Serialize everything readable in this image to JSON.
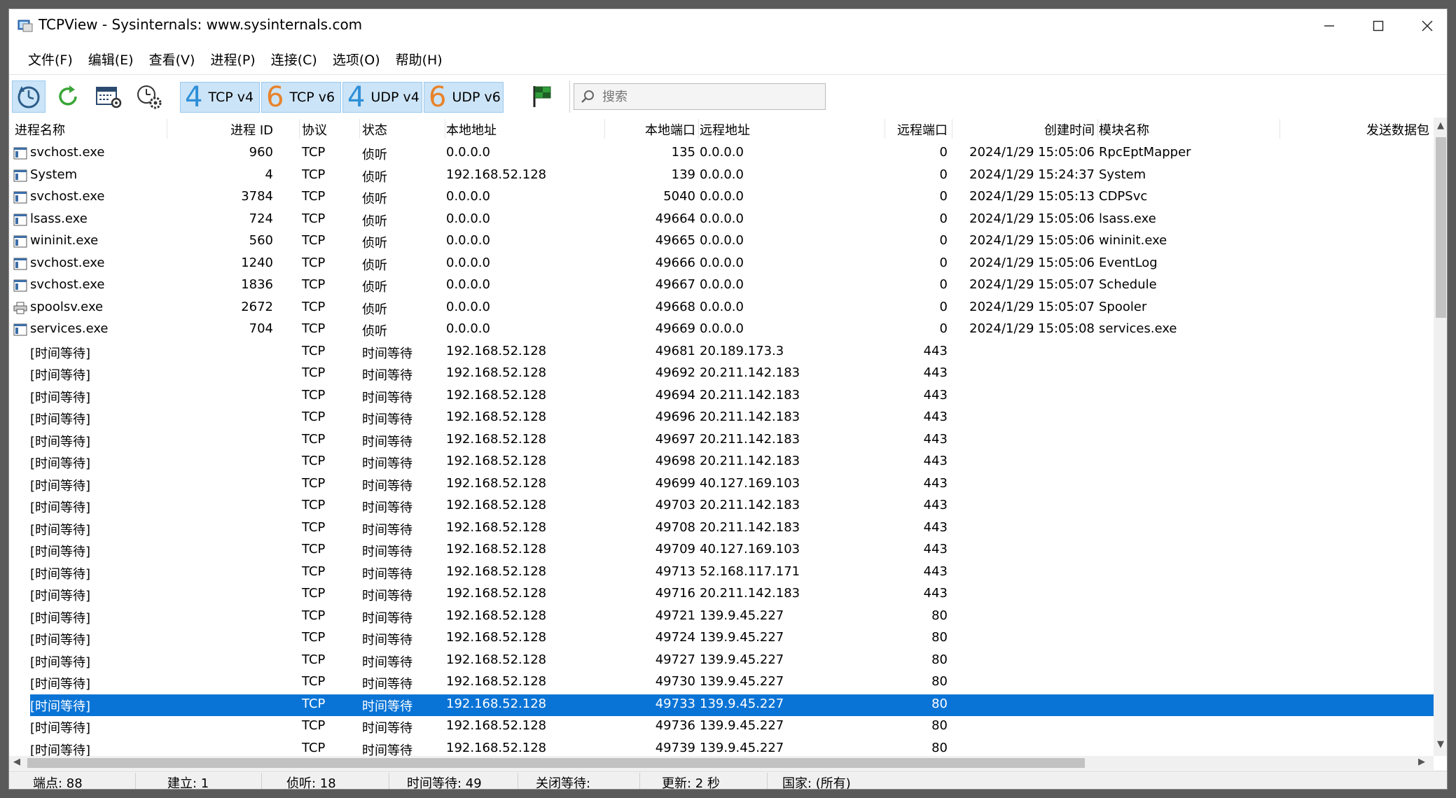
{
  "window": {
    "title": "TCPView - Sysinternals: www.sysinternals.com"
  },
  "menu": [
    "文件(F)",
    "编辑(E)",
    "查看(V)",
    "进程(P)",
    "连接(C)",
    "选项(O)",
    "帮助(H)"
  ],
  "toolbar": {
    "toggles": [
      {
        "num": "4",
        "label": "TCP v4",
        "color": "#2e8fd8"
      },
      {
        "num": "6",
        "label": "TCP v6",
        "color": "#e8822a"
      },
      {
        "num": "4",
        "label": "UDP v4",
        "color": "#2e8fd8"
      },
      {
        "num": "6",
        "label": "UDP v6",
        "color": "#e8822a"
      }
    ],
    "search_placeholder": "搜索"
  },
  "columns": {
    "process": "进程名称",
    "pid": "进程 ID",
    "protocol": "协议",
    "state": "状态",
    "local_addr": "本地地址",
    "local_port": "本地端口",
    "remote_addr": "远程地址",
    "remote_port": "远程端口",
    "created": "创建时间",
    "module": "模块名称",
    "sent_packets": "发送数据包"
  },
  "rows": [
    {
      "process": "svchost.exe",
      "pid": "960",
      "protocol": "TCP",
      "state": "侦听",
      "local_addr": "0.0.0.0",
      "local_port": "135",
      "remote_addr": "0.0.0.0",
      "remote_port": "0",
      "created": "2024/1/29 15:05:06",
      "module": "RpcEptMapper",
      "icon": "window"
    },
    {
      "process": "System",
      "pid": "4",
      "protocol": "TCP",
      "state": "侦听",
      "local_addr": "192.168.52.128",
      "local_port": "139",
      "remote_addr": "0.0.0.0",
      "remote_port": "0",
      "created": "2024/1/29 15:24:37",
      "module": "System",
      "icon": "window"
    },
    {
      "process": "svchost.exe",
      "pid": "3784",
      "protocol": "TCP",
      "state": "侦听",
      "local_addr": "0.0.0.0",
      "local_port": "5040",
      "remote_addr": "0.0.0.0",
      "remote_port": "0",
      "created": "2024/1/29 15:05:13",
      "module": "CDPSvc",
      "icon": "window"
    },
    {
      "process": "lsass.exe",
      "pid": "724",
      "protocol": "TCP",
      "state": "侦听",
      "local_addr": "0.0.0.0",
      "local_port": "49664",
      "remote_addr": "0.0.0.0",
      "remote_port": "0",
      "created": "2024/1/29 15:05:06",
      "module": "lsass.exe",
      "icon": "window"
    },
    {
      "process": "wininit.exe",
      "pid": "560",
      "protocol": "TCP",
      "state": "侦听",
      "local_addr": "0.0.0.0",
      "local_port": "49665",
      "remote_addr": "0.0.0.0",
      "remote_port": "0",
      "created": "2024/1/29 15:05:06",
      "module": "wininit.exe",
      "icon": "window"
    },
    {
      "process": "svchost.exe",
      "pid": "1240",
      "protocol": "TCP",
      "state": "侦听",
      "local_addr": "0.0.0.0",
      "local_port": "49666",
      "remote_addr": "0.0.0.0",
      "remote_port": "0",
      "created": "2024/1/29 15:05:06",
      "module": "EventLog",
      "icon": "window"
    },
    {
      "process": "svchost.exe",
      "pid": "1836",
      "protocol": "TCP",
      "state": "侦听",
      "local_addr": "0.0.0.0",
      "local_port": "49667",
      "remote_addr": "0.0.0.0",
      "remote_port": "0",
      "created": "2024/1/29 15:05:07",
      "module": "Schedule",
      "icon": "window"
    },
    {
      "process": "spoolsv.exe",
      "pid": "2672",
      "protocol": "TCP",
      "state": "侦听",
      "local_addr": "0.0.0.0",
      "local_port": "49668",
      "remote_addr": "0.0.0.0",
      "remote_port": "0",
      "created": "2024/1/29 15:05:07",
      "module": "Spooler",
      "icon": "printer"
    },
    {
      "process": "services.exe",
      "pid": "704",
      "protocol": "TCP",
      "state": "侦听",
      "local_addr": "0.0.0.0",
      "local_port": "49669",
      "remote_addr": "0.0.0.0",
      "remote_port": "0",
      "created": "2024/1/29 15:05:08",
      "module": "services.exe",
      "icon": "window"
    },
    {
      "process": "[时间等待]",
      "pid": "",
      "protocol": "TCP",
      "state": "时间等待",
      "local_addr": "192.168.52.128",
      "local_port": "49681",
      "remote_addr": "20.189.173.3",
      "remote_port": "443",
      "created": "",
      "module": "",
      "icon": ""
    },
    {
      "process": "[时间等待]",
      "pid": "",
      "protocol": "TCP",
      "state": "时间等待",
      "local_addr": "192.168.52.128",
      "local_port": "49692",
      "remote_addr": "20.211.142.183",
      "remote_port": "443",
      "created": "",
      "module": "",
      "icon": ""
    },
    {
      "process": "[时间等待]",
      "pid": "",
      "protocol": "TCP",
      "state": "时间等待",
      "local_addr": "192.168.52.128",
      "local_port": "49694",
      "remote_addr": "20.211.142.183",
      "remote_port": "443",
      "created": "",
      "module": "",
      "icon": ""
    },
    {
      "process": "[时间等待]",
      "pid": "",
      "protocol": "TCP",
      "state": "时间等待",
      "local_addr": "192.168.52.128",
      "local_port": "49696",
      "remote_addr": "20.211.142.183",
      "remote_port": "443",
      "created": "",
      "module": "",
      "icon": ""
    },
    {
      "process": "[时间等待]",
      "pid": "",
      "protocol": "TCP",
      "state": "时间等待",
      "local_addr": "192.168.52.128",
      "local_port": "49697",
      "remote_addr": "20.211.142.183",
      "remote_port": "443",
      "created": "",
      "module": "",
      "icon": ""
    },
    {
      "process": "[时间等待]",
      "pid": "",
      "protocol": "TCP",
      "state": "时间等待",
      "local_addr": "192.168.52.128",
      "local_port": "49698",
      "remote_addr": "20.211.142.183",
      "remote_port": "443",
      "created": "",
      "module": "",
      "icon": ""
    },
    {
      "process": "[时间等待]",
      "pid": "",
      "protocol": "TCP",
      "state": "时间等待",
      "local_addr": "192.168.52.128",
      "local_port": "49699",
      "remote_addr": "40.127.169.103",
      "remote_port": "443",
      "created": "",
      "module": "",
      "icon": ""
    },
    {
      "process": "[时间等待]",
      "pid": "",
      "protocol": "TCP",
      "state": "时间等待",
      "local_addr": "192.168.52.128",
      "local_port": "49703",
      "remote_addr": "20.211.142.183",
      "remote_port": "443",
      "created": "",
      "module": "",
      "icon": ""
    },
    {
      "process": "[时间等待]",
      "pid": "",
      "protocol": "TCP",
      "state": "时间等待",
      "local_addr": "192.168.52.128",
      "local_port": "49708",
      "remote_addr": "20.211.142.183",
      "remote_port": "443",
      "created": "",
      "module": "",
      "icon": ""
    },
    {
      "process": "[时间等待]",
      "pid": "",
      "protocol": "TCP",
      "state": "时间等待",
      "local_addr": "192.168.52.128",
      "local_port": "49709",
      "remote_addr": "40.127.169.103",
      "remote_port": "443",
      "created": "",
      "module": "",
      "icon": ""
    },
    {
      "process": "[时间等待]",
      "pid": "",
      "protocol": "TCP",
      "state": "时间等待",
      "local_addr": "192.168.52.128",
      "local_port": "49713",
      "remote_addr": "52.168.117.171",
      "remote_port": "443",
      "created": "",
      "module": "",
      "icon": ""
    },
    {
      "process": "[时间等待]",
      "pid": "",
      "protocol": "TCP",
      "state": "时间等待",
      "local_addr": "192.168.52.128",
      "local_port": "49716",
      "remote_addr": "20.211.142.183",
      "remote_port": "443",
      "created": "",
      "module": "",
      "icon": ""
    },
    {
      "process": "[时间等待]",
      "pid": "",
      "protocol": "TCP",
      "state": "时间等待",
      "local_addr": "192.168.52.128",
      "local_port": "49721",
      "remote_addr": "139.9.45.227",
      "remote_port": "80",
      "created": "",
      "module": "",
      "icon": ""
    },
    {
      "process": "[时间等待]",
      "pid": "",
      "protocol": "TCP",
      "state": "时间等待",
      "local_addr": "192.168.52.128",
      "local_port": "49724",
      "remote_addr": "139.9.45.227",
      "remote_port": "80",
      "created": "",
      "module": "",
      "icon": ""
    },
    {
      "process": "[时间等待]",
      "pid": "",
      "protocol": "TCP",
      "state": "时间等待",
      "local_addr": "192.168.52.128",
      "local_port": "49727",
      "remote_addr": "139.9.45.227",
      "remote_port": "80",
      "created": "",
      "module": "",
      "icon": ""
    },
    {
      "process": "[时间等待]",
      "pid": "",
      "protocol": "TCP",
      "state": "时间等待",
      "local_addr": "192.168.52.128",
      "local_port": "49730",
      "remote_addr": "139.9.45.227",
      "remote_port": "80",
      "created": "",
      "module": "",
      "icon": ""
    },
    {
      "process": "[时间等待]",
      "pid": "",
      "protocol": "TCP",
      "state": "时间等待",
      "local_addr": "192.168.52.128",
      "local_port": "49733",
      "remote_addr": "139.9.45.227",
      "remote_port": "80",
      "created": "",
      "module": "",
      "icon": "",
      "selected": true
    },
    {
      "process": "[时间等待]",
      "pid": "",
      "protocol": "TCP",
      "state": "时间等待",
      "local_addr": "192.168.52.128",
      "local_port": "49736",
      "remote_addr": "139.9.45.227",
      "remote_port": "80",
      "created": "",
      "module": "",
      "icon": ""
    },
    {
      "process": "[时间等待]",
      "pid": "",
      "protocol": "TCP",
      "state": "时间等待",
      "local_addr": "192.168.52.128",
      "local_port": "49739",
      "remote_addr": "139.9.45.227",
      "remote_port": "80",
      "created": "",
      "module": "",
      "icon": ""
    }
  ],
  "status": {
    "endpoints": "端点: 88",
    "established": "建立: 1",
    "listening": "侦听: 18",
    "time_wait": "时间等待: 49",
    "close_wait": "关闭等待:",
    "refresh": "更新: 2 秒",
    "country": "国家: (所有)"
  },
  "colors": {
    "selection": "#0a74d6",
    "toggle_bg": "#cce4f7"
  }
}
